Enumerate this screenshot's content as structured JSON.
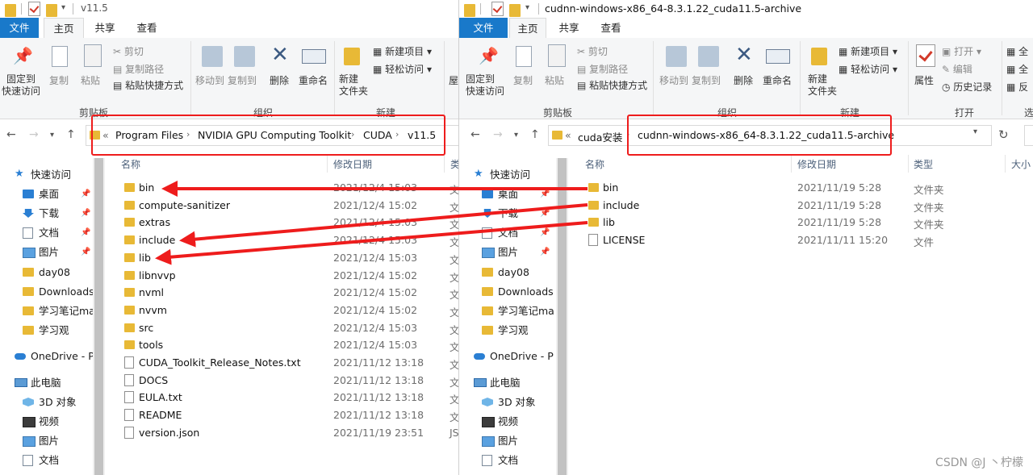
{
  "left": {
    "title": "v11.5",
    "tabs": [
      "文件",
      "主页",
      "共享",
      "查看"
    ],
    "ribbon": {
      "pin": "固定到\n快速访问",
      "copy": "复制",
      "paste": "粘贴",
      "cut": "剪切",
      "copy_path": "复制路径",
      "paste_shortcut": "粘贴快捷方式",
      "move_to": "移动到",
      "copy_to": "复制到",
      "delete": "删除",
      "rename": "重命名",
      "new_folder": "新建\n文件夹",
      "new_item": "新建项目",
      "easy_access": "轻松访问",
      "open_partial": "屋",
      "group_clipboard": "剪贴板",
      "group_organize": "组织",
      "group_new": "新建"
    },
    "breadcrumb": [
      "«",
      "Program Files",
      "NVIDIA GPU Computing Toolkit",
      "CUDA",
      "v11.5"
    ],
    "columns": {
      "name": "名称",
      "date": "修改日期",
      "type": "类"
    },
    "nav": [
      {
        "icon": "star",
        "label": "快速访问"
      },
      {
        "icon": "blue",
        "label": "桌面",
        "pinned": true
      },
      {
        "icon": "dl",
        "label": "下载",
        "pinned": true
      },
      {
        "icon": "docs",
        "label": "文档",
        "pinned": true
      },
      {
        "icon": "pics",
        "label": "图片",
        "pinned": true
      },
      {
        "icon": "folder",
        "label": "day08"
      },
      {
        "icon": "folder",
        "label": "Downloads"
      },
      {
        "icon": "folder",
        "label": "学习笔记ma"
      },
      {
        "icon": "folder",
        "label": "学习观"
      },
      {
        "icon": "cloud",
        "label": "OneDrive - P"
      },
      {
        "icon": "pc",
        "label": "此电脑"
      },
      {
        "icon": "cube",
        "label": "3D 对象"
      },
      {
        "icon": "video",
        "label": "视频"
      },
      {
        "icon": "pics",
        "label": "图片"
      },
      {
        "icon": "docs",
        "label": "文档"
      }
    ],
    "files": [
      {
        "kind": "folder",
        "name": "bin",
        "date": "2021/12/4 15:03",
        "type": "文"
      },
      {
        "kind": "folder",
        "name": "compute-sanitizer",
        "date": "2021/12/4 15:02",
        "type": "文"
      },
      {
        "kind": "folder",
        "name": "extras",
        "date": "2021/12/4 15:03",
        "type": "文"
      },
      {
        "kind": "folder",
        "name": "include",
        "date": "2021/12/4 15:03",
        "type": "文"
      },
      {
        "kind": "folder",
        "name": "lib",
        "date": "2021/12/4 15:03",
        "type": "文"
      },
      {
        "kind": "folder",
        "name": "libnvvp",
        "date": "2021/12/4 15:02",
        "type": "文"
      },
      {
        "kind": "folder",
        "name": "nvml",
        "date": "2021/12/4 15:02",
        "type": "文"
      },
      {
        "kind": "folder",
        "name": "nvvm",
        "date": "2021/12/4 15:02",
        "type": "文"
      },
      {
        "kind": "folder",
        "name": "src",
        "date": "2021/12/4 15:03",
        "type": "文"
      },
      {
        "kind": "folder",
        "name": "tools",
        "date": "2021/12/4 15:03",
        "type": "文"
      },
      {
        "kind": "file",
        "name": "CUDA_Toolkit_Release_Notes.txt",
        "date": "2021/11/12 13:18",
        "type": "文"
      },
      {
        "kind": "file",
        "name": "DOCS",
        "date": "2021/11/12 13:18",
        "type": "文"
      },
      {
        "kind": "file",
        "name": "EULA.txt",
        "date": "2021/11/12 13:18",
        "type": "文"
      },
      {
        "kind": "file",
        "name": "README",
        "date": "2021/11/12 13:18",
        "type": "文"
      },
      {
        "kind": "json",
        "name": "version.json",
        "date": "2021/11/19 23:51",
        "type": "JS"
      }
    ]
  },
  "right": {
    "title": "cudnn-windows-x86_64-8.3.1.22_cuda11.5-archive",
    "tabs": [
      "文件",
      "主页",
      "共享",
      "查看"
    ],
    "ribbon": {
      "pin": "固定到\n快速访问",
      "copy": "复制",
      "paste": "粘贴",
      "cut": "剪切",
      "copy_path": "复制路径",
      "paste_shortcut": "粘贴快捷方式",
      "move_to": "移动到",
      "copy_to": "复制到",
      "delete": "删除",
      "rename": "重命名",
      "new_folder": "新建\n文件夹",
      "new_item": "新建项目",
      "easy_access": "轻松访问",
      "properties": "属性",
      "open": "打开",
      "edit": "编辑",
      "history": "历史记录",
      "select_all_partial": "全",
      "select_none_partial": "全",
      "invert_partial": "反",
      "group_clipboard": "剪贴板",
      "group_organize": "组织",
      "group_new": "新建",
      "group_open": "打开",
      "group_select_partial": "选"
    },
    "breadcrumb": [
      "«",
      "cuda安装",
      "cudnn-windows-x86_64-8.3.1.22_cuda11.5-archive"
    ],
    "columns": {
      "name": "名称",
      "date": "修改日期",
      "type": "类型",
      "size": "大小"
    },
    "nav": [
      {
        "icon": "star",
        "label": "快速访问"
      },
      {
        "icon": "blue",
        "label": "桌面",
        "pinned": true
      },
      {
        "icon": "dl",
        "label": "下载",
        "pinned": true
      },
      {
        "icon": "docs",
        "label": "文档",
        "pinned": true
      },
      {
        "icon": "pics",
        "label": "图片",
        "pinned": true
      },
      {
        "icon": "folder",
        "label": "day08"
      },
      {
        "icon": "folder",
        "label": "Downloads"
      },
      {
        "icon": "folder",
        "label": "学习笔记ma"
      },
      {
        "icon": "folder",
        "label": "学习观"
      },
      {
        "icon": "cloud",
        "label": "OneDrive - P"
      },
      {
        "icon": "pc",
        "label": "此电脑"
      },
      {
        "icon": "cube",
        "label": "3D 对象"
      },
      {
        "icon": "video",
        "label": "视频"
      },
      {
        "icon": "pics",
        "label": "图片"
      },
      {
        "icon": "docs",
        "label": "文档"
      }
    ],
    "files": [
      {
        "kind": "folder",
        "name": "bin",
        "date": "2021/11/19 5:28",
        "type": "文件夹"
      },
      {
        "kind": "folder",
        "name": "include",
        "date": "2021/11/19 5:28",
        "type": "文件夹"
      },
      {
        "kind": "folder",
        "name": "lib",
        "date": "2021/11/19 5:28",
        "type": "文件夹"
      },
      {
        "kind": "file",
        "name": "LICENSE",
        "date": "2021/11/11 15:20",
        "type": "文件"
      }
    ]
  },
  "annotation_color": "#ee1c1c",
  "watermark": "CSDN @J 丶柠檬"
}
